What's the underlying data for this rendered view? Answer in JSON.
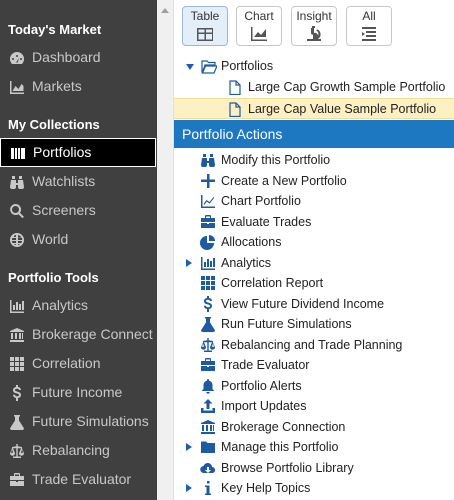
{
  "sidebar": {
    "sections": [
      {
        "title": "Today's Market"
      },
      {
        "title": "My Collections"
      },
      {
        "title": "Portfolio Tools"
      }
    ],
    "items": [
      {
        "label": "Dashboard",
        "icon": "dashboard-icon"
      },
      {
        "label": "Markets",
        "icon": "area-chart-icon"
      },
      {
        "label": "Portfolios",
        "icon": "portfolio-icon",
        "active": true
      },
      {
        "label": "Watchlists",
        "icon": "binoculars-icon"
      },
      {
        "label": "Screeners",
        "icon": "search-icon"
      },
      {
        "label": "World",
        "icon": "globe-icon"
      },
      {
        "label": "Analytics",
        "icon": "bar-chart-icon"
      },
      {
        "label": "Brokerage Connect",
        "icon": "bank-icon"
      },
      {
        "label": "Correlation",
        "icon": "grid-icon"
      },
      {
        "label": "Future Income",
        "icon": "dollar-icon"
      },
      {
        "label": "Future Simulations",
        "icon": "flask-icon"
      },
      {
        "label": "Rebalancing",
        "icon": "scale-icon"
      },
      {
        "label": "Trade Evaluator",
        "icon": "briefcase-icon"
      }
    ]
  },
  "toolbar": {
    "buttons": [
      {
        "label": "Table",
        "icon": "table-icon",
        "selected": true
      },
      {
        "label": "Chart",
        "icon": "line-chart-icon"
      },
      {
        "label": "Insight",
        "icon": "microscope-icon"
      },
      {
        "label": "All",
        "icon": "list-icon"
      }
    ]
  },
  "tree": {
    "root": "Portfolios",
    "children": [
      "Large Cap Growth Sample Portfolio",
      "Large Cap Value Sample Portfolio"
    ]
  },
  "actions_header": "Portfolio Actions",
  "actions": [
    {
      "label": "Modify this Portfolio",
      "icon": "binoculars-icon"
    },
    {
      "label": "Create a New Portfolio",
      "icon": "plus-icon"
    },
    {
      "label": "Chart Portfolio",
      "icon": "area-chart-icon"
    },
    {
      "label": "Evaluate Trades",
      "icon": "briefcase-icon"
    },
    {
      "label": "Allocations",
      "icon": "pie-chart-icon"
    },
    {
      "label": "Analytics",
      "icon": "bar-chart-icon",
      "expandable": true
    },
    {
      "label": "Correlation Report",
      "icon": "grid-icon"
    },
    {
      "label": "View Future Dividend Income",
      "icon": "dollar-icon"
    },
    {
      "label": "Run Future Simulations",
      "icon": "flask-icon"
    },
    {
      "label": "Rebalancing and Trade Planning",
      "icon": "scale-icon"
    },
    {
      "label": "Trade Evaluator",
      "icon": "briefcase-icon"
    },
    {
      "label": "Portfolio Alerts",
      "icon": "bell-icon"
    },
    {
      "label": "Import Updates",
      "icon": "upload-icon"
    },
    {
      "label": "Brokerage Connection",
      "icon": "bank-icon"
    },
    {
      "label": "Manage this Portfolio",
      "icon": "folder-icon",
      "expandable": true
    },
    {
      "label": "Browse Portfolio Library",
      "icon": "cloud-download-icon"
    },
    {
      "label": "Key Help Topics",
      "icon": "info-icon",
      "expandable": true
    }
  ],
  "colors": {
    "sidebar_bg": "#404040",
    "accent": "#1d77c1",
    "highlight": "#fdf0c2",
    "icon": "#1e5aa0"
  }
}
